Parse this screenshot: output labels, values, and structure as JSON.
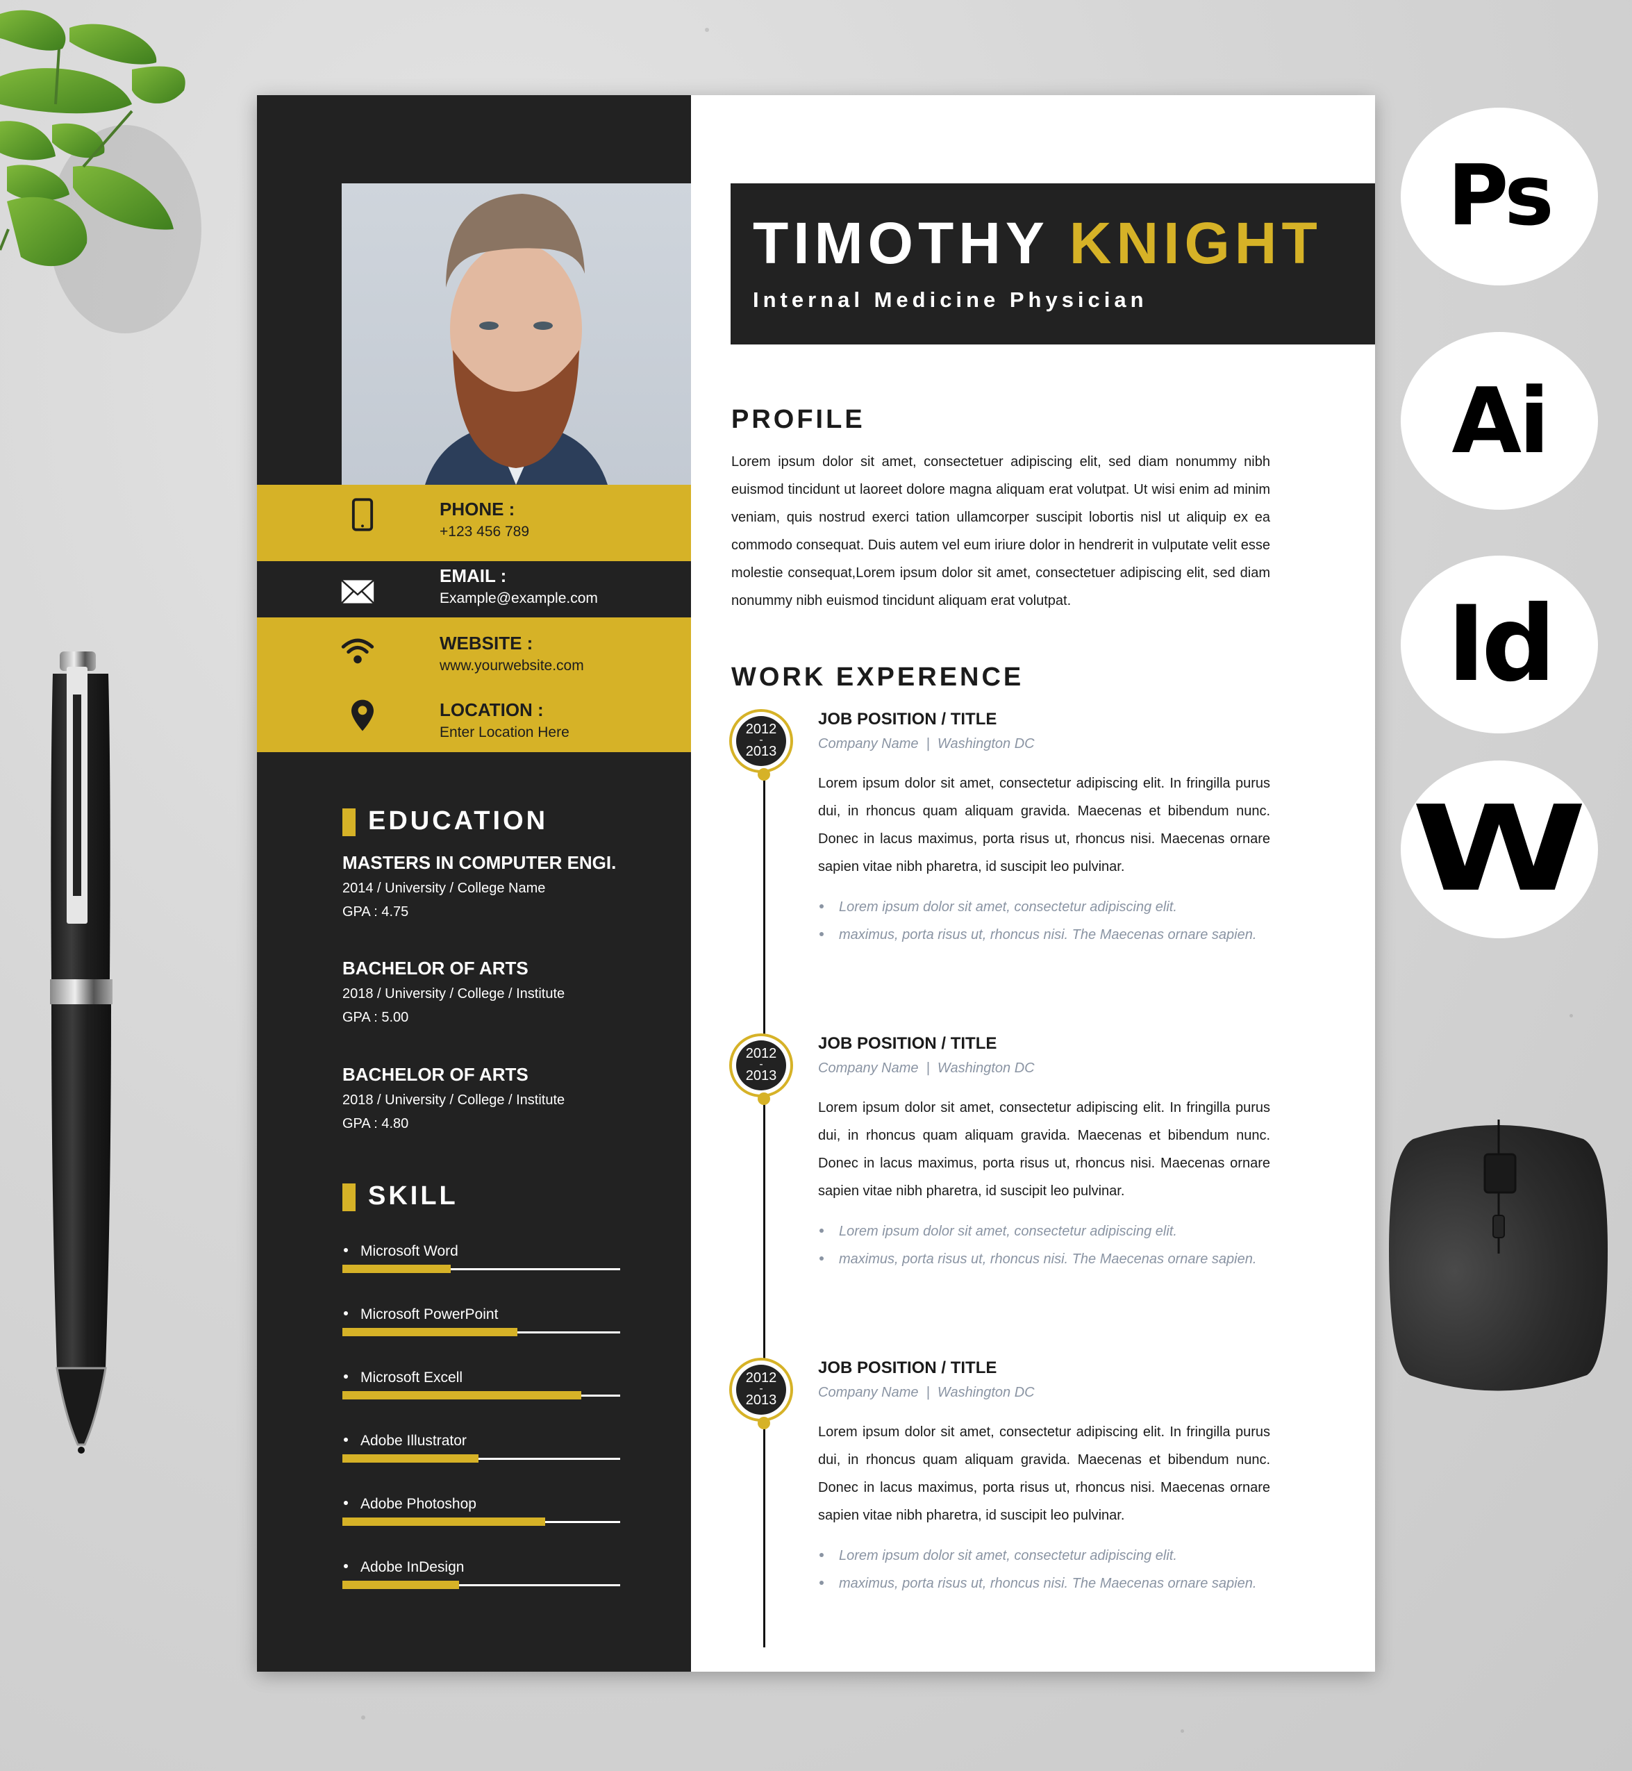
{
  "resume": {
    "name_first": "TIMOTHY",
    "name_last": "KNIGHT",
    "job_title": "Internal Medicine Physician",
    "contact": [
      {
        "icon": "phone-icon",
        "label": "PHONE :",
        "value": "+123 456 789"
      },
      {
        "icon": "email-icon",
        "label": "EMAIL :",
        "value": "Example@example.com"
      },
      {
        "icon": "wifi-icon",
        "label": "WEBSITE :",
        "value": "www.yourwebsite.com"
      },
      {
        "icon": "location-pin-icon",
        "label": "LOCATION :",
        "value": "Enter Location Here"
      }
    ],
    "education": {
      "heading": "EDUCATION",
      "items": [
        {
          "degree": "MASTERS IN COMPUTER ENGI.",
          "detail": "2014 / University / College Name",
          "gpa": "GPA : 4.75"
        },
        {
          "degree": "BACHELOR OF ARTS",
          "detail": "2018 / University / College / Institute",
          "gpa": "GPA : 5.00"
        },
        {
          "degree": "BACHELOR OF ARTS",
          "detail": "2018 / University / College / Institute",
          "gpa": "GPA : 4.80"
        }
      ]
    },
    "skills": {
      "heading": "SKILL",
      "items": [
        {
          "name": "Microsoft Word",
          "level": 0.39
        },
        {
          "name": "Microsoft PowerPoint",
          "level": 0.63
        },
        {
          "name": "Microsoft Excell",
          "level": 0.86
        },
        {
          "name": "Adobe Illustrator",
          "level": 0.49
        },
        {
          "name": "Adobe Photoshop",
          "level": 0.73
        },
        {
          "name": "Adobe InDesign",
          "level": 0.42
        }
      ]
    },
    "profile": {
      "heading": "PROFILE",
      "text": "Lorem ipsum dolor sit amet, consectetuer adipiscing elit, sed diam nonummy nibh euismod tincidunt ut laoreet dolore magna aliquam erat volutpat. Ut wisi enim ad minim veniam, quis nostrud exerci tation ullamcorper suscipit lobortis nisl ut aliquip ex ea commodo consequat. Duis autem vel eum iriure dolor in hendrerit in vulputate velit esse molestie consequat,Lorem ipsum dolor sit amet, consectetuer adipiscing elit, sed diam nonummy nibh euismod tincidunt aliquam erat volutpat."
    },
    "work": {
      "heading": "WORK EXPERENCE",
      "jobs": [
        {
          "year_start": "2012",
          "year_sep": "-",
          "year_end": "2013",
          "title": "JOB POSITION / TITLE",
          "company": "Company Name  |  Washington DC",
          "description": "Lorem ipsum dolor sit amet, consectetur adipiscing elit. In fringilla purus dui, in rhoncus quam aliquam gravida. Maecenas et bibendum nunc. Donec in lacus maximus, porta risus ut, rhoncus nisi. Maecenas ornare sapien vitae nibh pharetra, id suscipit leo pulvinar.",
          "bullets": [
            "Lorem ipsum dolor sit amet, consectetur adipiscing elit.",
            "maximus, porta risus ut, rhoncus nisi. The Maecenas ornare sapien."
          ]
        },
        {
          "year_start": "2012",
          "year_sep": "-",
          "year_end": "2013",
          "title": "JOB POSITION / TITLE",
          "company": "Company Name  |  Washington DC",
          "description": "Lorem ipsum dolor sit amet, consectetur adipiscing elit. In fringilla purus dui, in rhoncus quam aliquam gravida. Maecenas et bibendum nunc. Donec in lacus maximus, porta risus ut, rhoncus nisi. Maecenas ornare sapien vitae nibh pharetra, id suscipit leo pulvinar.",
          "bullets": [
            "Lorem ipsum dolor sit amet, consectetur adipiscing elit.",
            "maximus, porta risus ut, rhoncus nisi. The Maecenas ornare sapien."
          ]
        },
        {
          "year_start": "2012",
          "year_sep": "-",
          "year_end": "2013",
          "title": "JOB POSITION / TITLE",
          "company": "Company Name  |  Washington DC",
          "description": "Lorem ipsum dolor sit amet, consectetur adipiscing elit. In fringilla purus dui, in rhoncus quam aliquam gravida. Maecenas et bibendum nunc. Donec in lacus maximus, porta risus ut, rhoncus nisi. Maecenas ornare sapien vitae nibh pharetra, id suscipit leo pulvinar.",
          "bullets": [
            "Lorem ipsum dolor sit amet, consectetur adipiscing elit.",
            "maximus, porta risus ut, rhoncus nisi. The Maecenas ornare sapien."
          ]
        }
      ]
    }
  },
  "software_badges": [
    "Ps",
    "Ai",
    "Id",
    "W"
  ],
  "colors": {
    "accent": "#d6b227",
    "dark": "#222222",
    "muted_text": "#8a94a3",
    "background": "#d6d6d6"
  }
}
